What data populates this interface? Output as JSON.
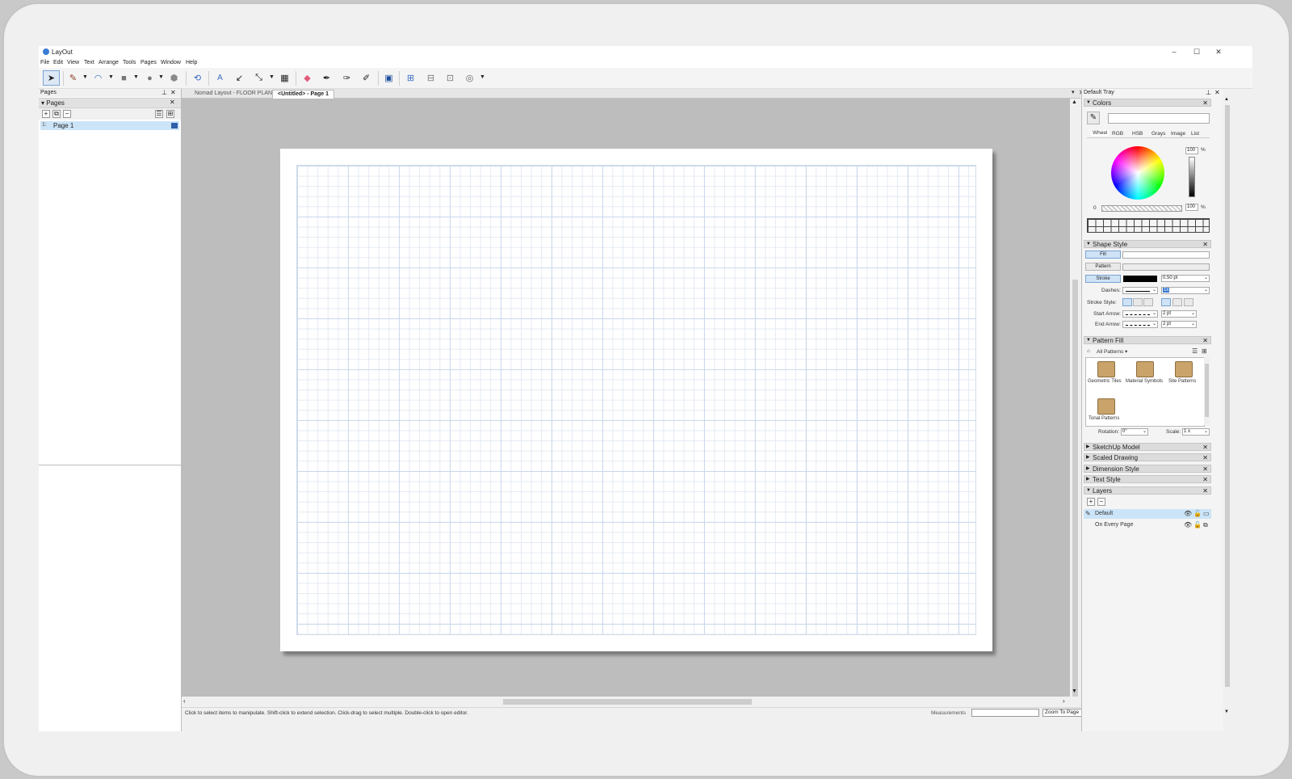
{
  "window": {
    "title": "LayOut",
    "controls": [
      "–",
      "☐",
      "✕"
    ]
  },
  "menu": [
    "File",
    "Edit",
    "View",
    "Text",
    "Arrange",
    "Tools",
    "Pages",
    "Window",
    "Help"
  ],
  "pages_panel": {
    "header": "Pages",
    "section": "Pages",
    "pages": [
      {
        "num": "1:",
        "label": "Page 1"
      }
    ]
  },
  "tabs": [
    {
      "label": "Nomad Layout - FLOOR PLAN",
      "active": false
    },
    {
      "label": "<Untitled> - Page 1",
      "active": true
    }
  ],
  "status": {
    "message": "Click to select items to manipulate. Shift-click to extend selection. Click-drag to select multiple. Double-click to open editor.",
    "measurements_label": "Measurements",
    "measurements_value": "",
    "zoom": "Zoom To Page"
  },
  "tray": {
    "title": "Default Tray",
    "colors": {
      "title": "Colors",
      "tabs": [
        "Wheel",
        "RGB",
        "HSB",
        "Grays",
        "Image",
        "List"
      ],
      "brightness": "100",
      "opacity_min": "0",
      "opacity": "100",
      "percent": "%"
    },
    "shape_style": {
      "title": "Shape Style",
      "fill": "Fill",
      "pattern": "Pattern",
      "stroke": "Stroke",
      "stroke_width": "0.50 pt",
      "dashes_label": "Dashes:",
      "dash_scale": "1x",
      "stroke_style_label": "Stroke Style:",
      "start_arrow_label": "Start Arrow:",
      "start_arrow_size": "2 pt",
      "end_arrow_label": "End Arrow:",
      "end_arrow_size": "2 pt"
    },
    "pattern_fill": {
      "title": "Pattern Fill",
      "filter": "All Patterns",
      "folders": [
        "Geometric Tiles",
        "Material Symbols",
        "Site Patterns",
        "Tonal Patterns"
      ],
      "rotation_label": "Rotation:",
      "rotation": "0°",
      "scale_label": "Scale:",
      "scale": "1 x"
    },
    "collapsed": [
      "SketchUp Model",
      "Scaled Drawing",
      "Dimension Style",
      "Text Style"
    ],
    "layers": {
      "title": "Layers",
      "items": [
        {
          "label": "Default",
          "selected": true
        },
        {
          "label": "On Every Page",
          "selected": false
        }
      ]
    }
  },
  "colors": {
    "accent": "#cce4f7",
    "canvas": "#bdbdbd",
    "grid": "#c8d7eb"
  }
}
